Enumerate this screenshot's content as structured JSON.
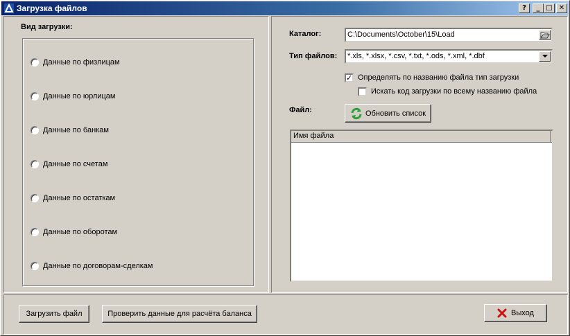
{
  "window": {
    "title": "Загрузка файлов",
    "controls": [
      "?",
      "_",
      "□",
      "✕"
    ]
  },
  "left_panel": {
    "group_label": "Вид загрузки:",
    "radios": [
      "Данные по физлицам",
      "Данные по юрлицам",
      "Данные по банкам",
      "Данные по счетам",
      "Данные по остаткам",
      "Данные по оборотам",
      "Данные по договорам-сделкам"
    ]
  },
  "right_panel": {
    "catalog_label": "Каталог:",
    "catalog_value": "C:\\Documents\\October\\15\\Load",
    "filetype_label": "Тип файлов:",
    "filetype_value": "*.xls, *.xlsx, *.csv, *.txt, *.ods, *.xml, *.dbf",
    "check_detect_label": "Определять по названию файла тип загрузки",
    "check_detect_checked": true,
    "check_search_label": "Искать код загрузки по всему названию файла",
    "check_search_checked": false,
    "file_label": "Файл:",
    "refresh_button": "Обновить список",
    "list_column": "Имя файла"
  },
  "bottom": {
    "load_button": "Загрузить файл",
    "verify_button": "Проверить данные для расчёта баланса",
    "exit_button": "Выход"
  },
  "colors": {
    "titlebar_start": "#0a246a",
    "refresh_icon": "#2e9e3a",
    "exit_icon": "#cc1111"
  },
  "icons": [
    "app-icon",
    "folder-open-icon",
    "dropdown-arrow-icon",
    "refresh-icon",
    "close-x-icon"
  ]
}
